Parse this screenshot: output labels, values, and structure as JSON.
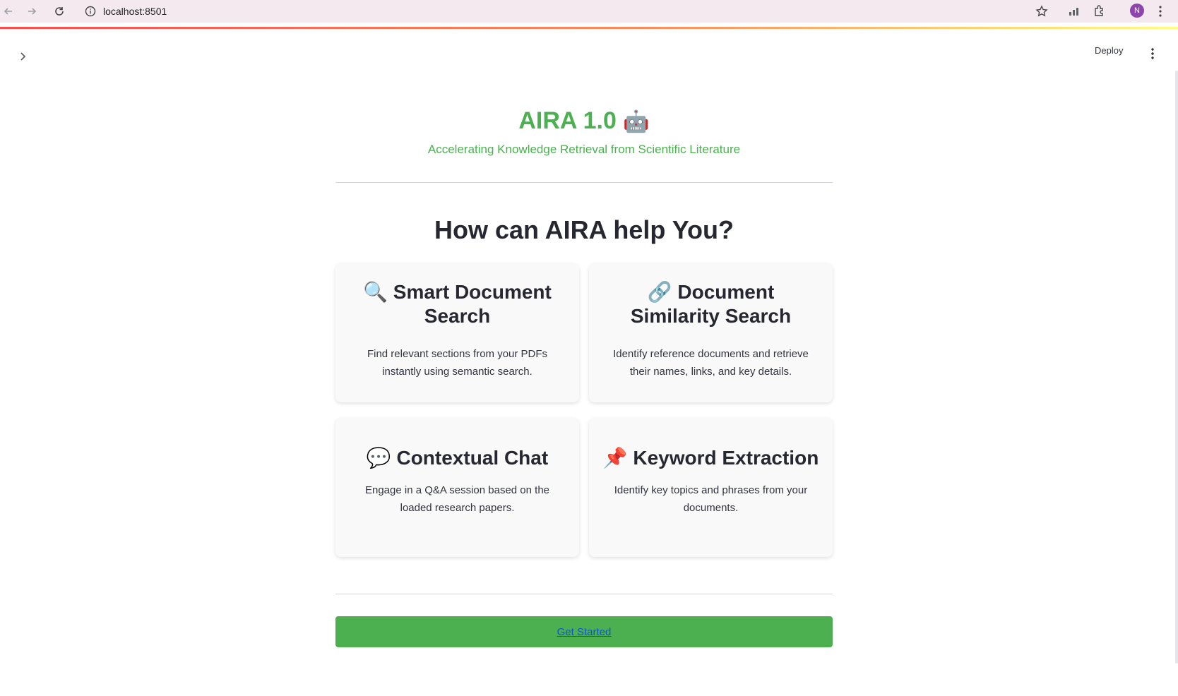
{
  "browser": {
    "url": "localhost:8501",
    "profile_initial": "N",
    "icons": {
      "back": "arrow-left-icon",
      "forward": "arrow-right-icon",
      "reload": "reload-icon",
      "site_info": "info-icon",
      "bookmark": "star-icon",
      "extension": "puzzle-icon",
      "menu": "kebab-icon"
    },
    "colors": {
      "profile": "#8e44ad"
    }
  },
  "header": {
    "deploy_label": "Deploy",
    "sidebar_toggle_icon": "chevron-right-icon",
    "menu_icon": "kebab-menu-icon"
  },
  "hero": {
    "title": "AIRA 1.0",
    "title_emoji": "🤖",
    "subtitle": "Accelerating Knowledge Retrieval from Scientific Literature",
    "accent_color": "#4caf50"
  },
  "features": {
    "heading": "How can AIRA help You?",
    "cards": [
      {
        "emoji": "🔍",
        "title": "Smart Document Search",
        "description": "Find relevant sections from your PDFs instantly using semantic search."
      },
      {
        "emoji": "🔗",
        "title": "Document Similarity Search",
        "description": "Identify reference documents and retrieve their names, links, and key details."
      },
      {
        "emoji": "💬",
        "title": "Contextual Chat",
        "description": "Engage in a Q&A session based on the loaded research papers."
      },
      {
        "emoji": "📌",
        "title": "Keyword Extraction",
        "description": "Identify key topics and phrases from your documents."
      }
    ]
  },
  "cta": {
    "label": "Get Started",
    "button_color": "#4caf50"
  }
}
